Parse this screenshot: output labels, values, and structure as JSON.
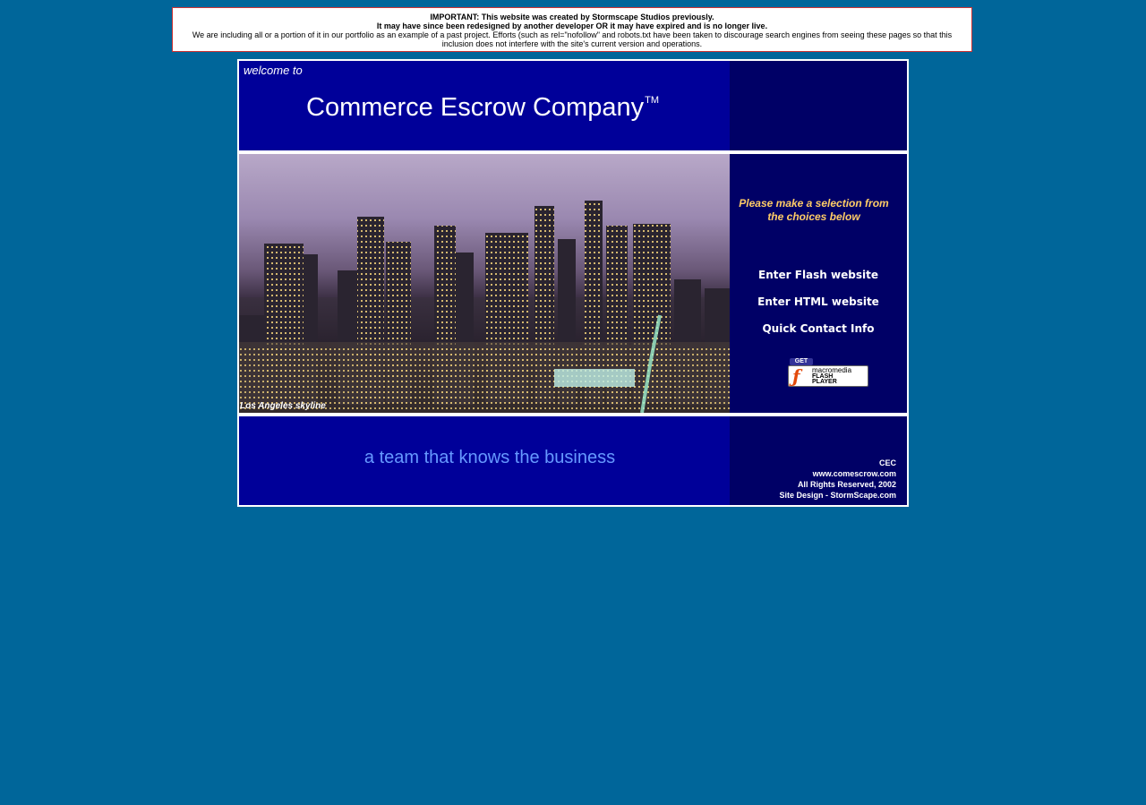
{
  "notice": {
    "line1": "IMPORTANT: This website was created by Stormscape Studios previously.",
    "line2": "It may have since been redesigned by another developer OR it may have expired and is no longer live.",
    "line3": "We are including all or a portion of it in our portfolio as an example of a past project. Efforts (such as rel=\"nofollow\" and robots.txt have been taken to discourage search engines from seeing these pages so that this inclusion does not interfere with the site's current version and operations."
  },
  "header": {
    "welcome": "welcome to",
    "company": "Commerce Escrow Company",
    "trademark": "TM"
  },
  "photo": {
    "caption": "Los Angeles skyline"
  },
  "menu": {
    "prompt": "Please make a selection from the choices below",
    "items": [
      {
        "label": "Enter Flash website"
      },
      {
        "label": "Enter HTML website"
      },
      {
        "label": "Quick Contact Info"
      }
    ],
    "flash_badge": {
      "get": "GET",
      "brand": "macromedia",
      "product_1": "FLASH",
      "product_2": "PLAYER",
      "icon": "flash-f-icon"
    }
  },
  "footer": {
    "tagline": "a team that knows the business",
    "credits": [
      "CEC",
      "www.comescrow.com",
      "All Rights Reserved, 2002",
      "Site Design - StormScape.com"
    ]
  },
  "colors": {
    "page_bg": "#00669a",
    "panel_blue": "#000099",
    "panel_dark": "#000066",
    "accent_gold": "#ffcc66",
    "tagline_blue": "#6699ff"
  }
}
